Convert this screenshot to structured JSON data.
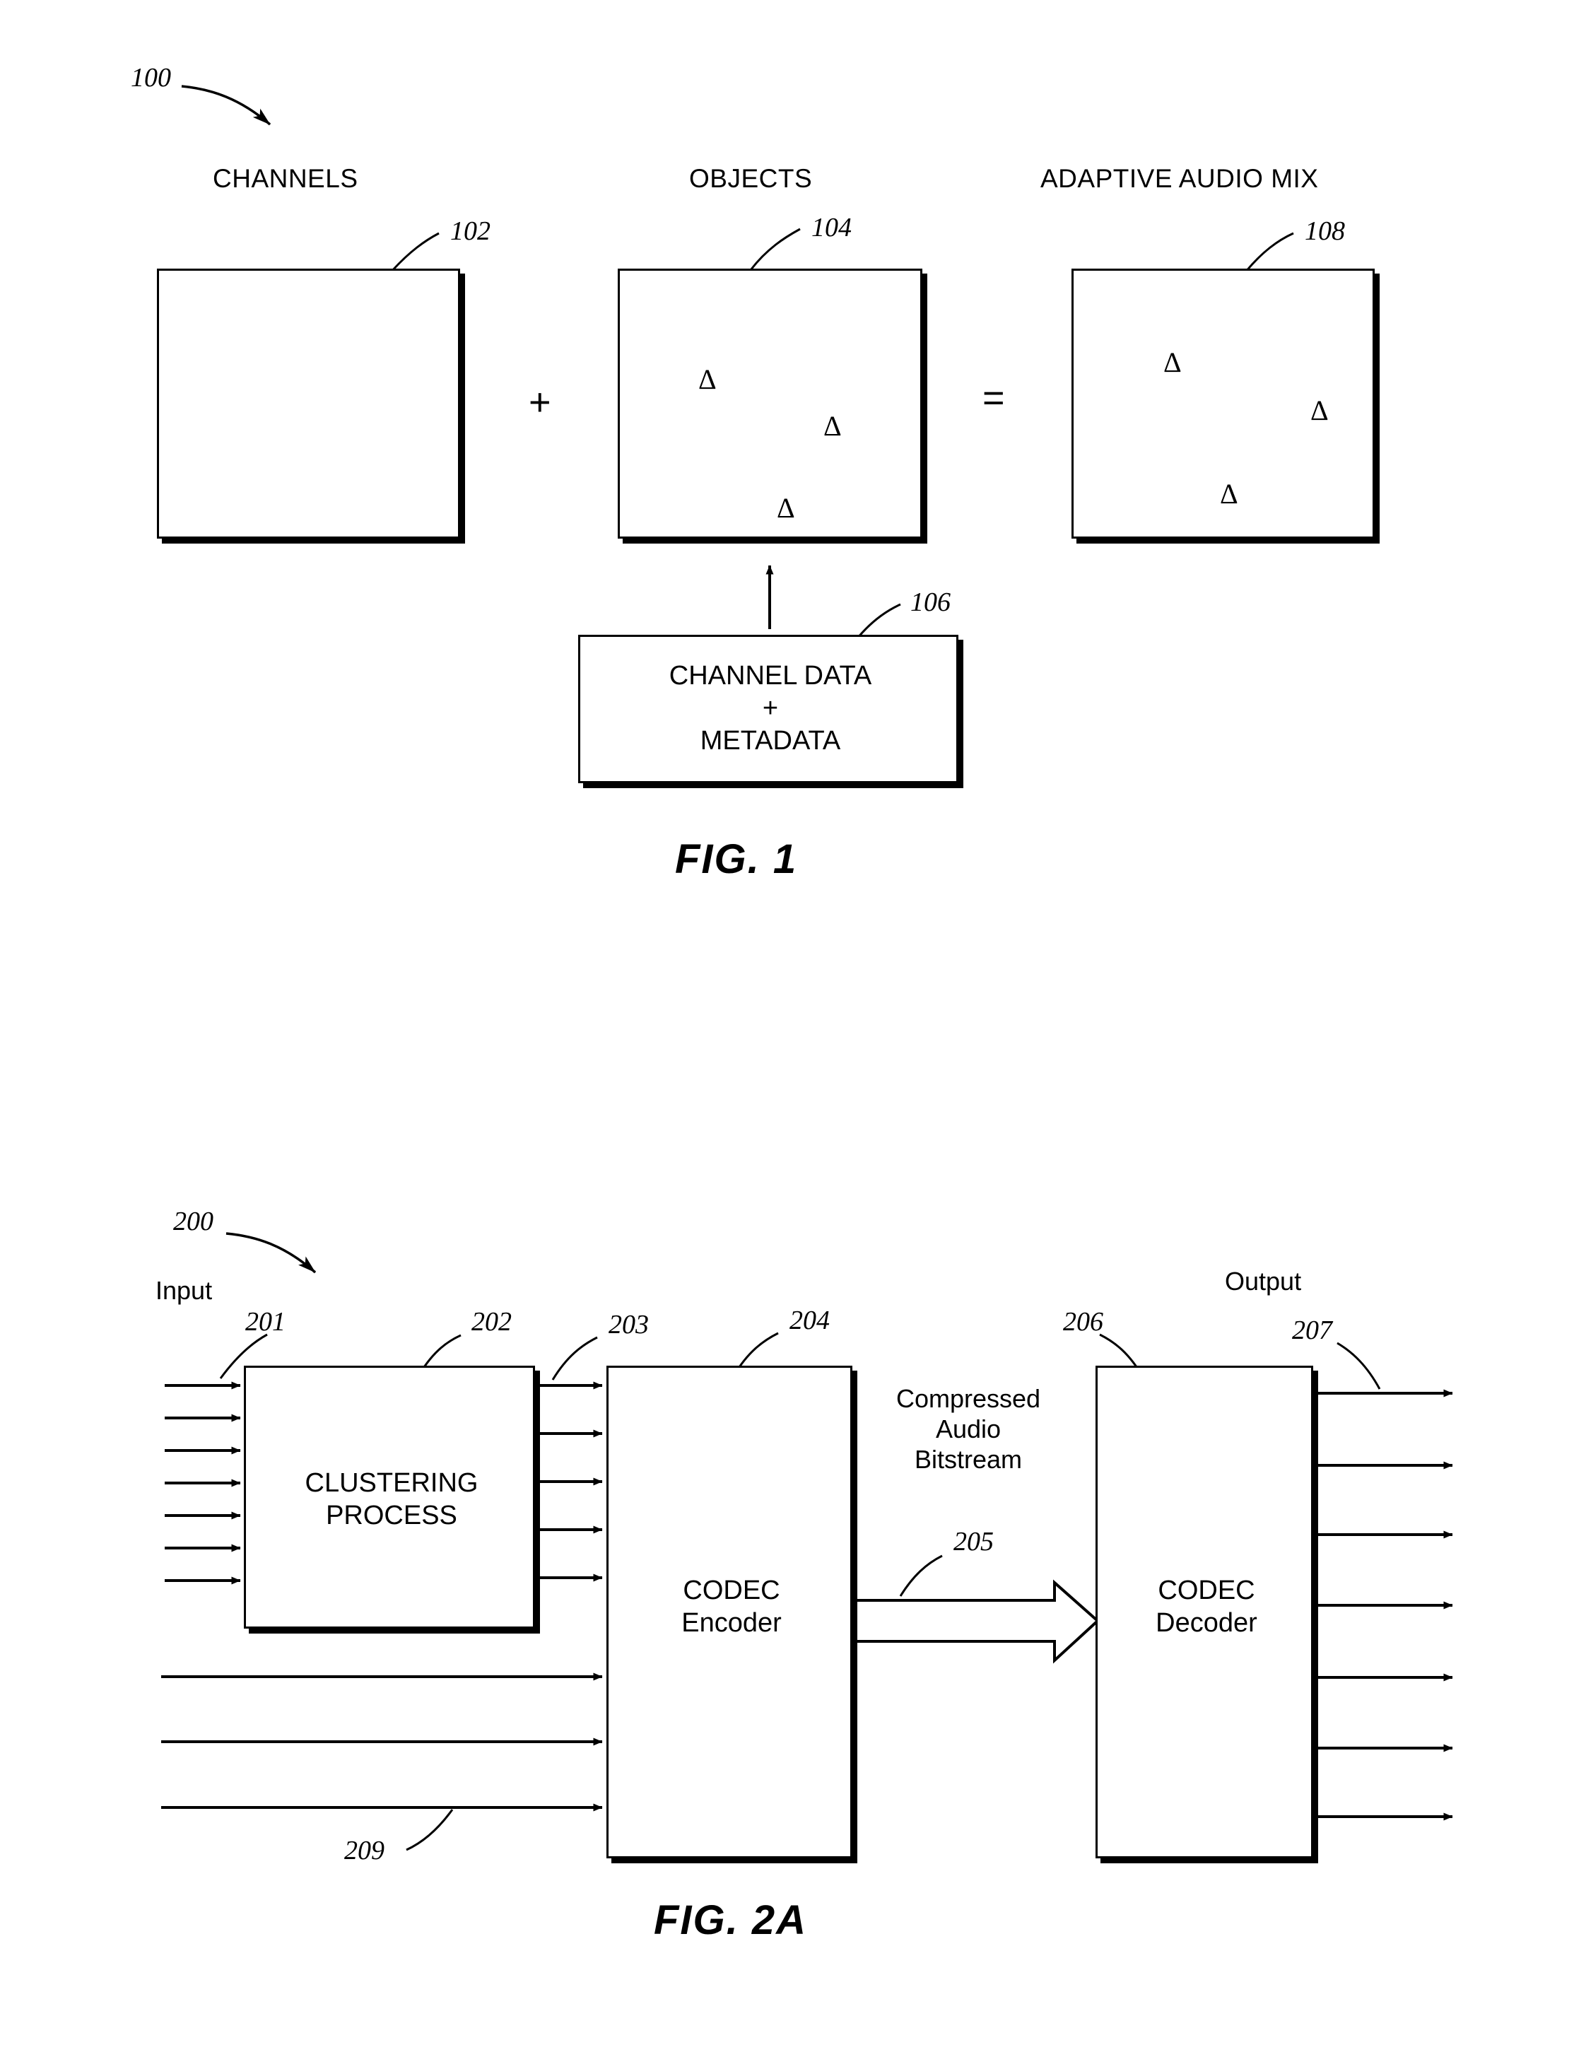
{
  "figure1": {
    "ref": "100",
    "headers": {
      "channels": "CHANNELS",
      "objects": "OBJECTS",
      "adaptive": "ADAPTIVE AUDIO MIX"
    },
    "refs": {
      "channels_box": "102",
      "objects_box": "104",
      "metadata_box": "106",
      "adaptive_box": "108"
    },
    "operators": {
      "plus": "+",
      "equals": "="
    },
    "metadata_box_lines": [
      "CHANNEL DATA",
      "+",
      "METADATA"
    ],
    "object_glyph": "Δ",
    "fig_label": "FIG. 1"
  },
  "figure2a": {
    "ref": "200",
    "input_label": "Input",
    "output_label": "Output",
    "refs": {
      "input_arrows": "201",
      "clustering_block": "202",
      "clustered_arrows": "203",
      "encoder_block": "204",
      "bitstream_arrow": "205",
      "decoder_block": "206",
      "output_arrows": "207",
      "bypass_arrows": "209"
    },
    "blocks": {
      "clustering": [
        "CLUSTERING",
        "PROCESS"
      ],
      "encoder": [
        "CODEC",
        "Encoder"
      ],
      "decoder": [
        "CODEC",
        "Decoder"
      ]
    },
    "bitstream_label": [
      "Compressed",
      "Audio",
      "Bitstream"
    ],
    "fig_label": "FIG. 2A",
    "counts": {
      "input_arrows": 7,
      "clustered_arrows": 5,
      "bypass_arrows": 3,
      "output_arrows": 7
    }
  },
  "colors": {
    "ink": "#000000",
    "paper": "#ffffff"
  }
}
